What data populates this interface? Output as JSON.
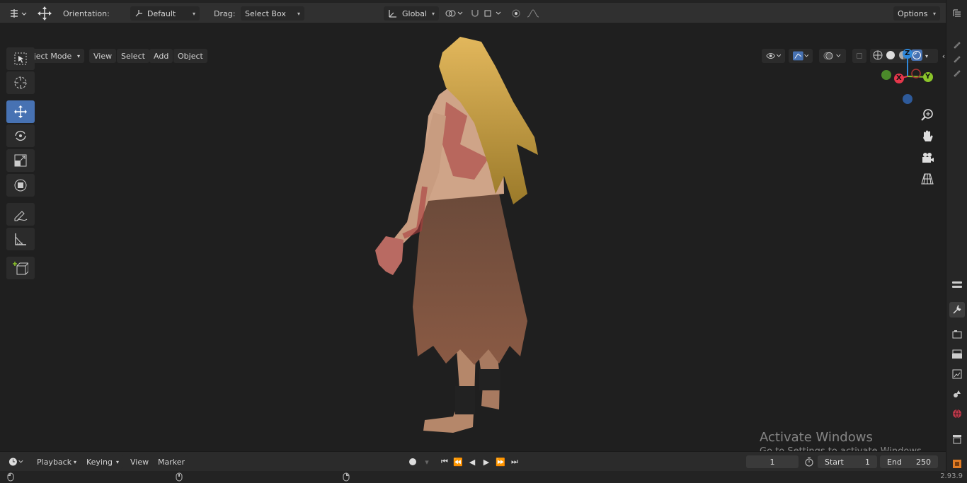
{
  "header": {
    "orientation_label": "Orientation:",
    "orientation_value": "Default",
    "drag_label": "Drag:",
    "drag_value": "Select Box",
    "transform_value": "Global",
    "options_label": "Options"
  },
  "viewport_header": {
    "mode": "Object Mode",
    "menus": [
      "View",
      "Select",
      "Add",
      "Object"
    ]
  },
  "toolbar": {
    "tools": [
      "select-box",
      "cursor",
      "move",
      "rotate",
      "scale",
      "transform",
      "annotate",
      "measure",
      "add-cube"
    ],
    "active_tool": "move"
  },
  "gizmo": {
    "z": "Z",
    "y": "Y",
    "x": "X"
  },
  "timeline": {
    "menus": [
      "Playback",
      "Keying",
      "View",
      "Marker"
    ],
    "current_frame": "1",
    "start_label": "Start",
    "start_value": "1",
    "end_label": "End",
    "end_value": "250"
  },
  "status": {
    "version": "2.93.9"
  },
  "watermark": {
    "line1": "Activate Windows",
    "line2": "Go to Settings to activate Windows."
  },
  "colors": {
    "accent": "#4772b3",
    "axis_x": "#e5374b",
    "axis_y": "#8bc42a",
    "axis_z": "#2f87d8"
  }
}
